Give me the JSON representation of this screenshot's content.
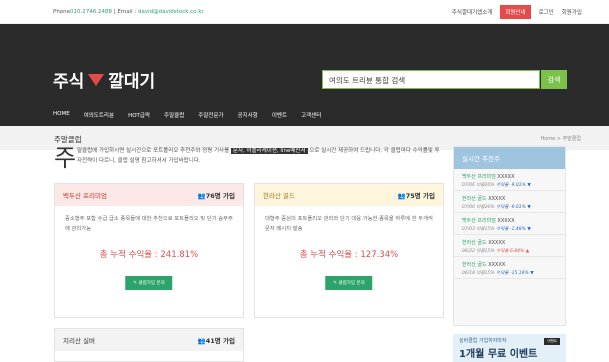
{
  "topbar": {
    "phone_label": "Phone",
    "phone": "010.2746.2488",
    "email_label": "Email",
    "email": "david@davidstock.co.kr",
    "links": [
      "주식깔대기앱소개",
      "회원안내",
      "로그인",
      "회원가입"
    ],
    "active_link_index": 1
  },
  "header": {
    "logo_left": "주식",
    "logo_right": "깔대기",
    "search_placeholder": "여의도 트리뷴 통합 검색",
    "search_button": "검색",
    "nav": [
      "HOME",
      "여의도트리뷴",
      "HOT급락",
      "주말클럽",
      "주말전문가",
      "공지사항",
      "이벤트",
      "고객센터"
    ]
  },
  "page": {
    "title": "주말클럽",
    "breadcrumb": "Home > 주말클럽"
  },
  "intro": {
    "big": "주",
    "text_before": "말클럽에 가입하시면 실시간으로 포트폴리오 추천주와 정평 기사를 ",
    "highlight": "문자, 어플리케이션, line메신저",
    "text_after": " 으로 실시간 제공하여 드립니다. 각 클럽마다 수익률및 투자전략이 다르니, 클럽 설명 참고하셔서 가입바랍니다."
  },
  "clubs": [
    {
      "name": "백두산 프리미엄",
      "count": "76명 가입",
      "desc": "중소형주 포함 수급 급소 종목들에 대한 추천으로 포트폴리오 및 단기 승부주에 관리가능",
      "profit": "총 누적 수익율 : 241.81%",
      "button": "클럽가입 문의"
    },
    {
      "name": "한라산 골드",
      "count": "75명 가입",
      "desc": "대형주 중심의 포트폴리오 관리와 단기 대응 가능한 종목을 하루에 한 두개씩 문자 메시지 발송",
      "profit": "총 누적 수익율 : 127.34%",
      "button": "클럽가입 문의"
    },
    {
      "name": "지리산 실버",
      "count": "41명 가입",
      "desc": ""
    }
  ],
  "colors": {
    "accent_red": "#e54b4b",
    "accent_green": "#2ca36a",
    "header_dark": "#2b2b2b",
    "sidebar_header": "#9ec4e0"
  },
  "sidebar": {
    "title": "실시간 추천주",
    "items": [
      {
        "club": "백두산 프리미엄",
        "stock": "XXXXX",
        "date": "07/06 비중20%",
        "rate": "수익율 -9.01%",
        "dir": "down"
      },
      {
        "club": "한라산 골드",
        "stock": "XXXXX",
        "date": "07/06 비중20%",
        "rate": "수익율 -9.01%",
        "dir": "down"
      },
      {
        "club": "백두산 프리미엄",
        "stock": "XXXXX",
        "date": "07/03 비중15%",
        "rate": "수익율 -1.48%",
        "dir": "down"
      },
      {
        "club": "한라산 골드",
        "stock": "XXXXX",
        "date": "06/22 비중15%",
        "rate": "수익율 6.84%",
        "dir": "up"
      },
      {
        "club": "한라산 골드",
        "stock": "XXXXX",
        "date": "06/18 비중15%",
        "rate": "수익율 -15.19%",
        "dir": "down"
      }
    ]
  },
  "banner": {
    "line1": "실버클럽 가입하자마자",
    "line2": "1개월 무료 이벤트",
    "tag": "이벤트"
  }
}
